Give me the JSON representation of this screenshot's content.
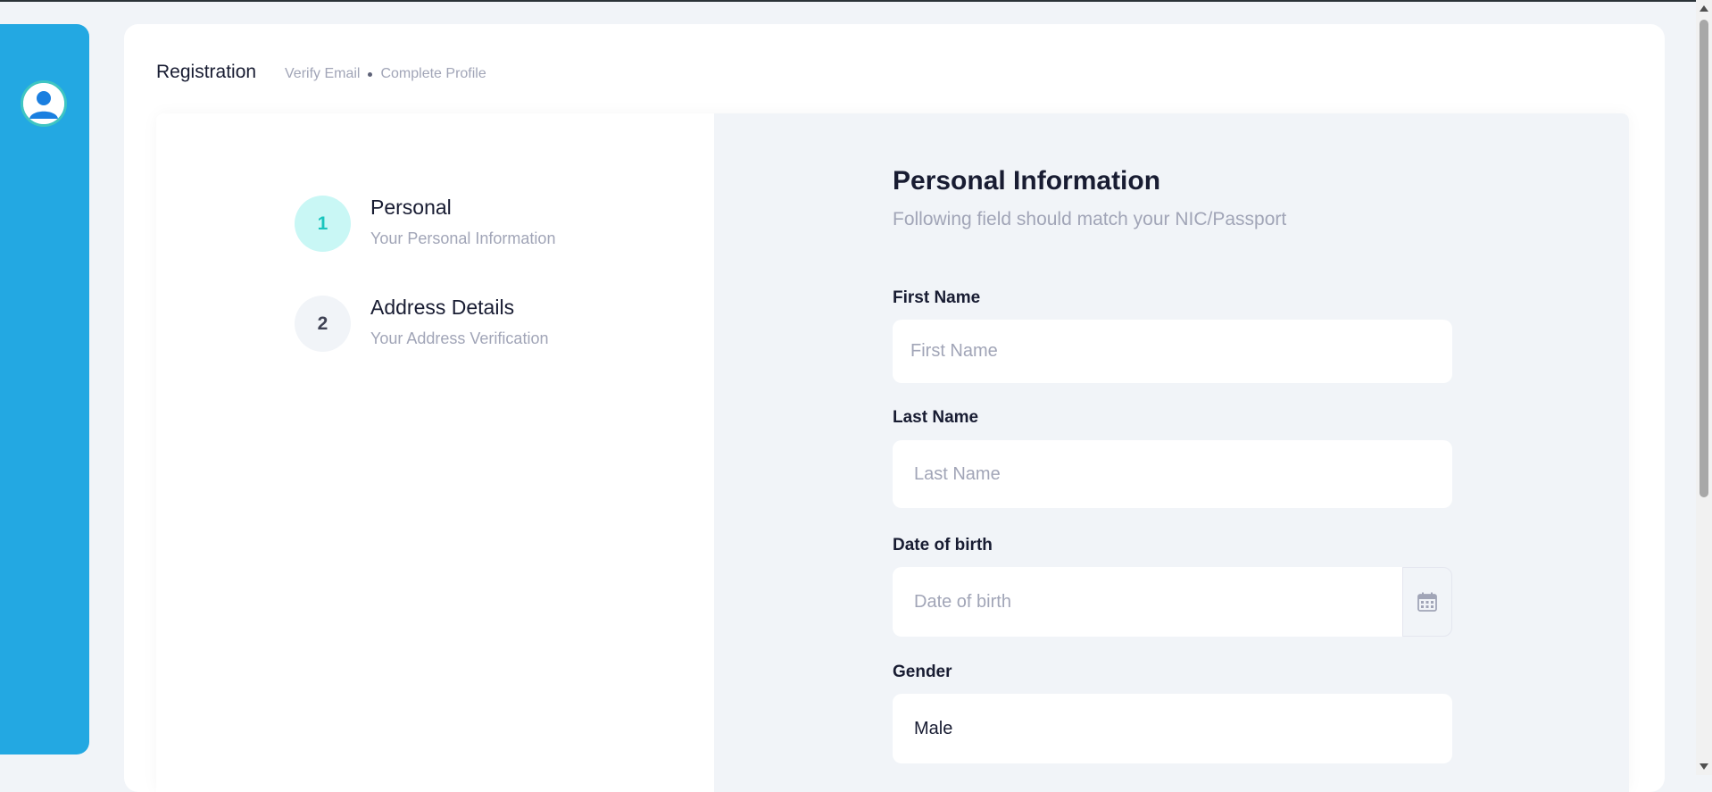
{
  "toolbar": {
    "title": "Registration",
    "breadcrumb": [
      "Verify Email",
      "Complete Profile"
    ]
  },
  "sidebar": {
    "avatar_icon": "user-avatar-icon"
  },
  "stepper": {
    "steps": [
      {
        "number": "1",
        "title": "Personal",
        "description": "Your Personal Information",
        "active": true
      },
      {
        "number": "2",
        "title": "Address Details",
        "description": "Your Address Verification",
        "active": false
      }
    ]
  },
  "form": {
    "title": "Personal Information",
    "subtitle": "Following field should match your NIC/Passport",
    "fields": {
      "first_name": {
        "label": "First Name",
        "placeholder": "First Name",
        "value": ""
      },
      "last_name": {
        "label": "Last Name",
        "placeholder": "Last Name",
        "value": ""
      },
      "dob": {
        "label": "Date of birth",
        "placeholder": "Date of birth",
        "value": "",
        "icon": "calendar-icon"
      },
      "gender": {
        "label": "Gender",
        "value": "Male"
      }
    }
  },
  "colors": {
    "sidebar": "#23a8e2",
    "active_step_bg": "#c9f7f5",
    "active_step_text": "#1bc5bd",
    "muted_text": "#a1a5b7",
    "form_bg": "#f1f4f8"
  }
}
